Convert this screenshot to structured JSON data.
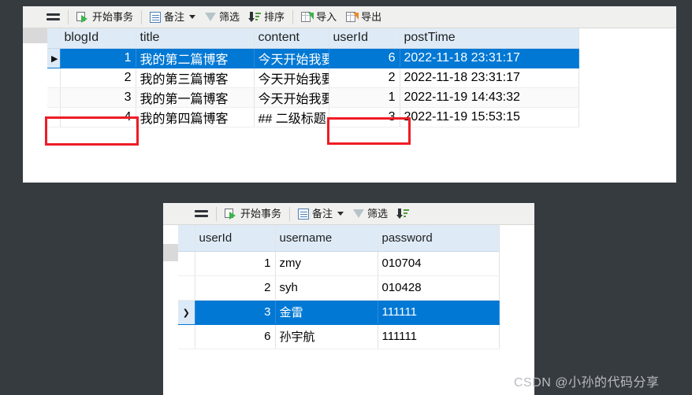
{
  "background_color": "#363b40",
  "accent_color": "#0078d4",
  "annotation_color": "#ee1c25",
  "header_color": "#deebf7",
  "toolbar": {
    "menu_icon": "hamburger-icon",
    "items": [
      {
        "label": "开始事务",
        "icon": "start-transaction-icon"
      },
      {
        "label": "备注",
        "icon": "note-icon",
        "has_dropdown": true
      },
      {
        "label": "筛选",
        "icon": "funnel-icon"
      },
      {
        "label": "排序",
        "icon": "sort-icon"
      },
      {
        "label": "导入",
        "icon": "import-sheet-icon"
      },
      {
        "label": "导出",
        "icon": "export-sheet-icon"
      }
    ]
  },
  "blog_table": {
    "columns": [
      "blogId",
      "title",
      "content",
      "userId",
      "postTime"
    ],
    "rows": [
      {
        "selected": true,
        "marker": "▶",
        "blogId": "1",
        "title": "我的第二篇博客",
        "content": "今天开始我要",
        "userId": "6",
        "postTime": "2022-11-18 23:31:17"
      },
      {
        "selected": false,
        "marker": "",
        "blogId": "2",
        "title": "我的第三篇博客",
        "content": "今天开始我要",
        "userId": "2",
        "postTime": "2022-11-18 23:31:17"
      },
      {
        "selected": false,
        "marker": "",
        "blogId": "3",
        "title": "我的第一篇博客",
        "content": "今天开始我要",
        "userId": "1",
        "postTime": "2022-11-19 14:43:32"
      },
      {
        "selected": false,
        "marker": "",
        "blogId": "4",
        "title": "我的第四篇博客",
        "content": "## 二级标题",
        "userId": "3",
        "postTime": "2022-11-19 15:53:15"
      }
    ]
  },
  "user_table": {
    "columns": [
      "userId",
      "username",
      "password"
    ],
    "rows": [
      {
        "selected": false,
        "marker": "",
        "userId": "1",
        "username": "zmy",
        "password": "010704"
      },
      {
        "selected": false,
        "marker": "",
        "userId": "2",
        "username": "syh",
        "password": "010428"
      },
      {
        "selected": true,
        "marker": "❯",
        "userId": "3",
        "username": "金雷",
        "password": "111111"
      },
      {
        "selected": false,
        "marker": "",
        "userId": "6",
        "username": "孙宇航",
        "password": "111111"
      }
    ]
  },
  "annotations": [
    {
      "name": "blogid-cell-highlight",
      "target": "blogId column of row 4"
    },
    {
      "name": "userid-cell-highlight",
      "target": "userId column of row 4"
    }
  ],
  "watermark": {
    "text": "CSDN @小孙的代码分享"
  }
}
